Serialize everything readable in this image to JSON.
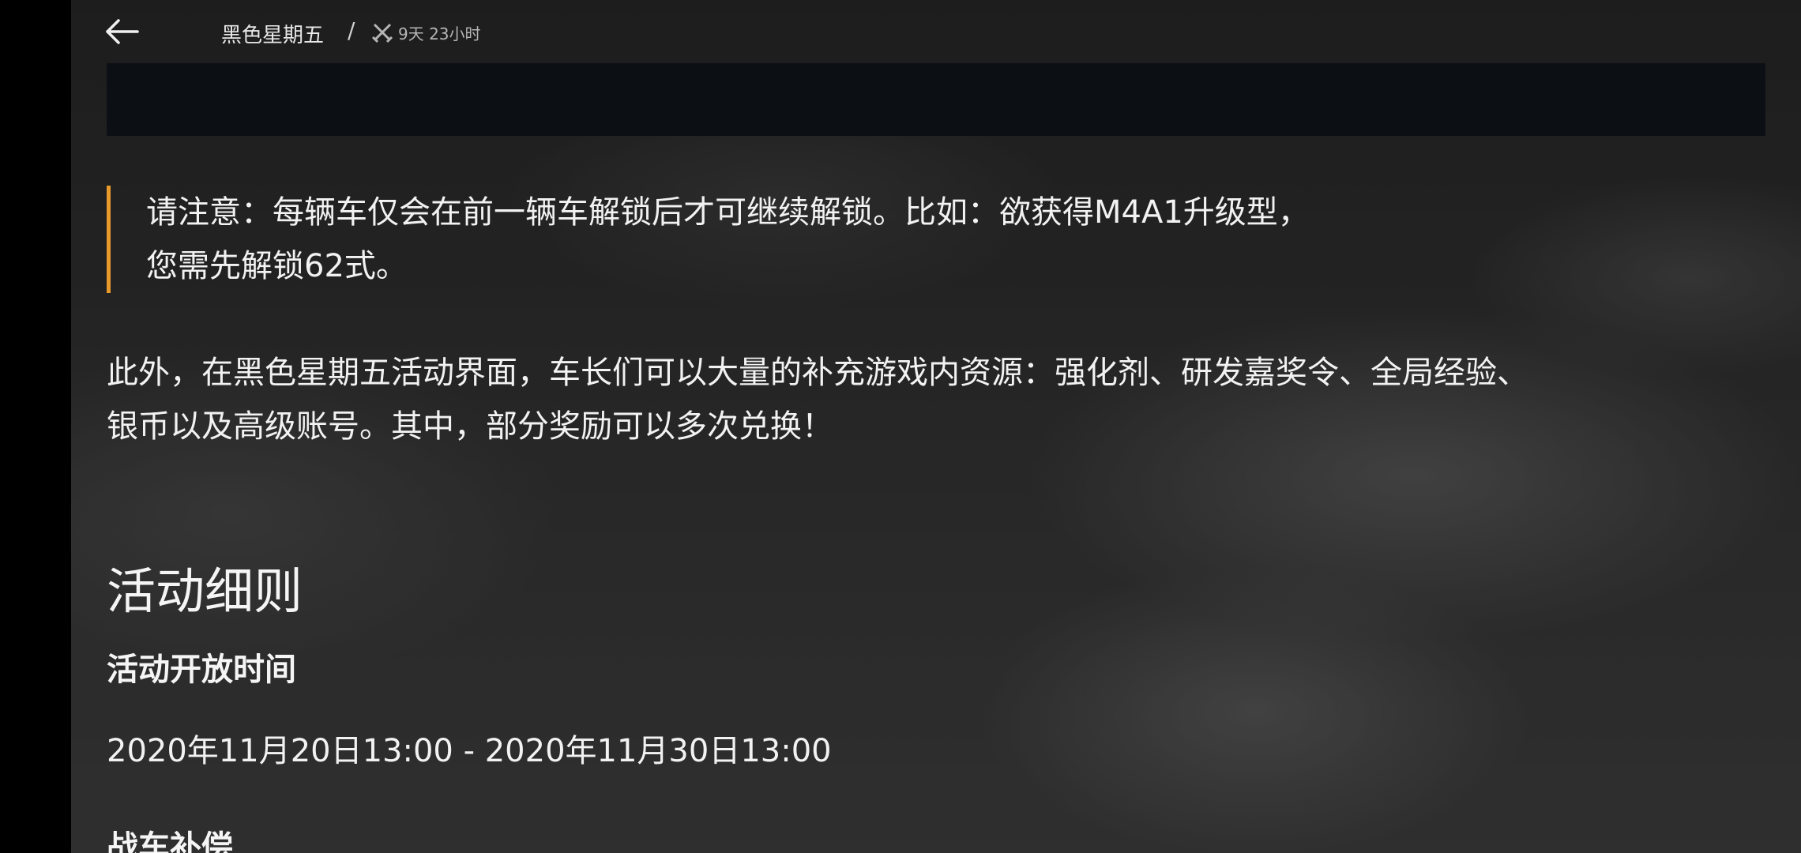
{
  "header": {
    "title": "黑色星期五",
    "separator": "/",
    "countdown": "9天 23小时",
    "back_icon": "back-arrow-icon",
    "countdown_icon": "crossed-swords-icon"
  },
  "note": {
    "line1": "请注意：每辆车仅会在前一辆车解锁后才可继续解锁。比如：欲获得M4A1升级型，",
    "line2": "您需先解锁62式。",
    "accent_color": "#e89a2a"
  },
  "intro": {
    "line1": "此外，在黑色星期五活动界面，车长们可以大量的补充游戏内资源：强化剂、研发嘉奖令、全局经验、",
    "line2": "银币以及高级账号。其中，部分奖励可以多次兑换！"
  },
  "rules": {
    "section_title": "活动细则",
    "open_time_title": "活动开放时间",
    "open_time_value": "2020年11月20日13:00 - 2020年11月30日13:00",
    "compensation_title": "战车补偿"
  }
}
